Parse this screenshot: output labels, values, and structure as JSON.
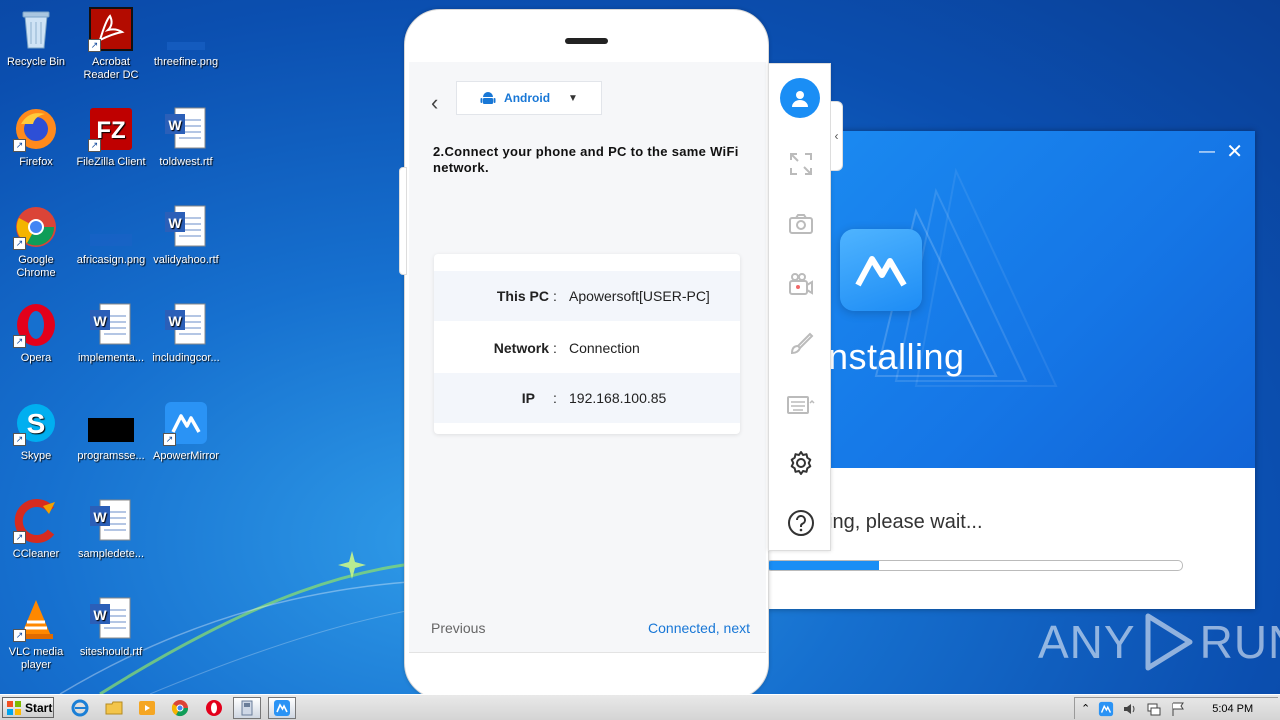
{
  "desktop": {
    "icons": [
      {
        "name": "recycle-bin",
        "label": "Recycle Bin"
      },
      {
        "name": "acrobat",
        "label": "Acrobat Reader DC"
      },
      {
        "name": "threefine",
        "label": "threefine.png"
      },
      {
        "name": "firefox",
        "label": "Firefox"
      },
      {
        "name": "filezilla",
        "label": "FileZilla Client"
      },
      {
        "name": "toldwest",
        "label": "toldwest.rtf"
      },
      {
        "name": "chrome",
        "label": "Google Chrome"
      },
      {
        "name": "africasign",
        "label": "africasign.png"
      },
      {
        "name": "validyahoo",
        "label": "validyahoo.rtf"
      },
      {
        "name": "opera",
        "label": "Opera"
      },
      {
        "name": "implementa",
        "label": "implementa..."
      },
      {
        "name": "includingcor",
        "label": "includingcor..."
      },
      {
        "name": "skype",
        "label": "Skype"
      },
      {
        "name": "programsse",
        "label": "programsse..."
      },
      {
        "name": "apowermirror",
        "label": "ApowerMirror"
      },
      {
        "name": "ccleaner",
        "label": "CCleaner"
      },
      {
        "name": "sampledete",
        "label": "sampledete..."
      },
      {
        "name": "vlc",
        "label": "VLC media player"
      },
      {
        "name": "siteshould",
        "label": "siteshould.rtf"
      }
    ]
  },
  "installer": {
    "title": "nstalling",
    "status": "ing, please wait...",
    "progress": 0.27,
    "accent": "#1a8ef5"
  },
  "phone": {
    "os_selected": "Android",
    "step_text": "2.Connect your phone and PC to the same WiFi network.",
    "info": {
      "pc_label": "This PC",
      "pc_value": "Apowersoft[USER-PC]",
      "network_label": "Network",
      "network_value": "Connection",
      "ip_label": "IP",
      "ip_value": "192.168.100.85",
      "separator": ":"
    },
    "previous_label": "Previous",
    "next_label": "Connected, next"
  },
  "toolbar": {
    "items": [
      "user-icon",
      "fullscreen-icon",
      "screenshot-icon",
      "record-icon",
      "draw-icon",
      "keyboard-icon",
      "settings-icon",
      "help-icon"
    ]
  },
  "watermark": {
    "left": "ANY",
    "right": "RUN"
  },
  "taskbar": {
    "start_label": "Start",
    "clock": "5:04 PM"
  }
}
